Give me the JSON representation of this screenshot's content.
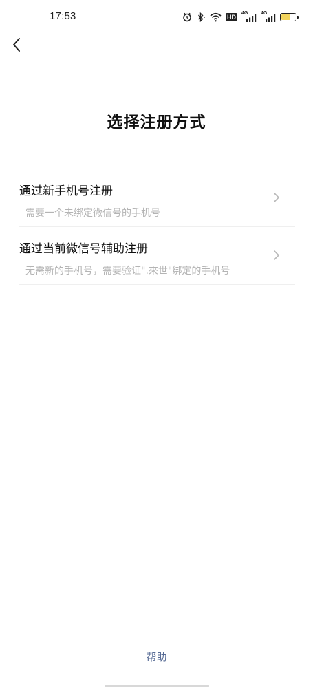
{
  "status_bar": {
    "time": "17:53",
    "icons": [
      "alarm-icon",
      "bluetooth-icon",
      "wifi-icon",
      "hd-icon",
      "signal-icon",
      "signal-icon",
      "battery-icon"
    ],
    "hd_label": "HD",
    "network_1": "4G",
    "network_2": "4G",
    "battery_level": 0.7,
    "battery_color": "#f2d45c"
  },
  "nav": {
    "back_icon": "chevron-left-icon"
  },
  "page": {
    "title": "选择注册方式"
  },
  "options": [
    {
      "title": "通过新手机号注册",
      "description": "需要一个未绑定微信号的手机号",
      "icon": "chevron-right-icon"
    },
    {
      "title": "通过当前微信号辅助注册",
      "description": "无需新的手机号，需要验证\".來世\"绑定的手机号",
      "icon": "chevron-right-icon"
    }
  ],
  "footer": {
    "help_label": "帮助",
    "help_color": "#576b95"
  }
}
